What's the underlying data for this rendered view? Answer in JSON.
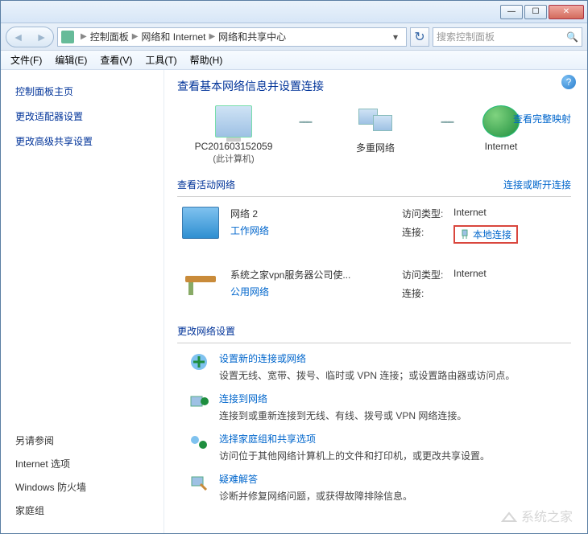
{
  "titlebar": {
    "min": "—",
    "max": "☐",
    "close": "✕"
  },
  "nav": {
    "breadcrumb": [
      "控制面板",
      "网络和 Internet",
      "网络和共享中心"
    ],
    "searchPlaceholder": "搜索控制面板"
  },
  "menu": [
    "文件(F)",
    "编辑(E)",
    "查看(V)",
    "工具(T)",
    "帮助(H)"
  ],
  "sidebar": {
    "title": "控制面板主页",
    "links": [
      "更改适配器设置",
      "更改高级共享设置"
    ],
    "seeAlsoTitle": "另请参阅",
    "seeAlso": [
      "Internet 选项",
      "Windows 防火墙",
      "家庭组"
    ]
  },
  "main": {
    "heading": "查看基本网络信息并设置连接",
    "map": {
      "pc": {
        "name": "PC201603152059",
        "sub": "(此计算机)"
      },
      "multi": {
        "name": "多重网络"
      },
      "internet": {
        "name": "Internet"
      },
      "fullMapLink": "查看完整映射"
    },
    "activeTitle": "查看活动网络",
    "activeRightLink": "连接或断开连接",
    "networks": [
      {
        "title": "网络 2",
        "type": "工作网络",
        "accessLabel": "访问类型:",
        "accessValue": "Internet",
        "connLabel": "连接:",
        "connValue": "本地连接",
        "highlight": true
      },
      {
        "title": "系统之家vpn服务器公司使...",
        "type": "公用网络",
        "accessLabel": "访问类型:",
        "accessValue": "Internet",
        "connLabel": "连接:",
        "connValue": ""
      }
    ],
    "changeTitle": "更改网络设置",
    "settings": [
      {
        "label": "设置新的连接或网络",
        "desc": "设置无线、宽带、拨号、临时或 VPN 连接；或设置路由器或访问点。"
      },
      {
        "label": "连接到网络",
        "desc": "连接到或重新连接到无线、有线、拨号或 VPN 网络连接。"
      },
      {
        "label": "选择家庭组和共享选项",
        "desc": "访问位于其他网络计算机上的文件和打印机，或更改共享设置。"
      },
      {
        "label": "疑难解答",
        "desc": "诊断并修复网络问题，或获得故障排除信息。"
      }
    ]
  },
  "watermark": "系统之家"
}
